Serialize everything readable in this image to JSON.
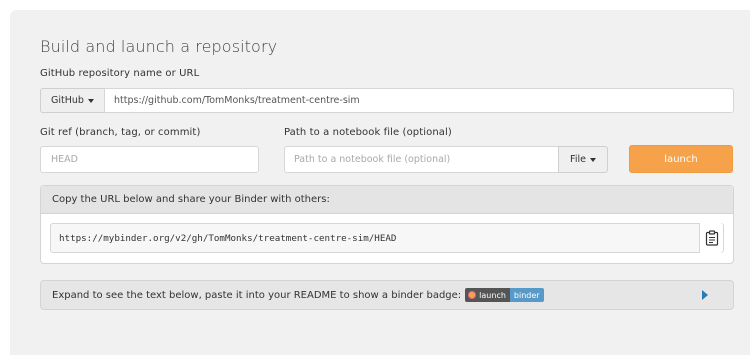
{
  "form": {
    "title": "Build and launch a repository",
    "repo_label": "GitHub repository name or URL",
    "provider_selected": "GitHub",
    "repo_value": "https://github.com/TomMonks/treatment-centre-sim",
    "ref_label": "Git ref (branch, tag, or commit)",
    "ref_placeholder": "HEAD",
    "path_label": "Path to a notebook file (optional)",
    "path_placeholder": "Path to a notebook file (optional)",
    "path_type_selected": "File",
    "launch_label": "launch"
  },
  "share": {
    "heading": "Copy the URL below and share your Binder with others:",
    "url": "https://mybinder.org/v2/gh/TomMonks/treatment-centre-sim/HEAD",
    "copy_icon": "clipboard-icon"
  },
  "badge_section": {
    "text": "Expand to see the text below, paste it into your README to show a binder badge:",
    "badge_left": "launch",
    "badge_right": "binder"
  },
  "colors": {
    "panel_bg": "#f1f1f1",
    "launch_button": "#f5a24a",
    "badge_right": "#579aca",
    "expand_arrow": "#2a7ab8"
  }
}
